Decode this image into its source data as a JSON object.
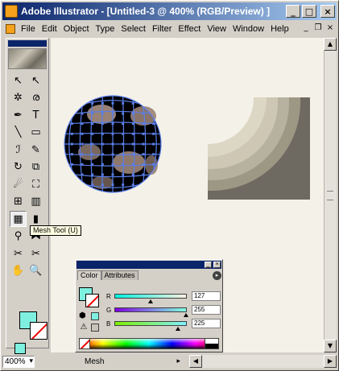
{
  "window": {
    "title": "Adobe Illustrator - [Untitled-3 @ 400% (RGB/Preview) ]",
    "minimize_label": "_",
    "maximize_label": "□",
    "close_label": "×"
  },
  "menubar": {
    "items": [
      "File",
      "Edit",
      "Object",
      "Type",
      "Select",
      "Filter",
      "Effect",
      "View",
      "Window",
      "Help"
    ],
    "doc_minimize": "_",
    "doc_restore": "❐",
    "doc_close": "×"
  },
  "toolbox": {
    "tooltip": "Mesh Tool (U)",
    "tools": [
      {
        "name": "selection-tool",
        "glyph": "↖"
      },
      {
        "name": "direct-selection-tool",
        "glyph": "↖"
      },
      {
        "name": "magic-wand-tool",
        "glyph": "✲"
      },
      {
        "name": "lasso-tool",
        "glyph": "ര"
      },
      {
        "name": "pen-tool",
        "glyph": "✒"
      },
      {
        "name": "type-tool",
        "glyph": "T"
      },
      {
        "name": "line-tool",
        "glyph": "╲"
      },
      {
        "name": "rectangle-tool",
        "glyph": "▭"
      },
      {
        "name": "paintbrush-tool",
        "glyph": "ℐ"
      },
      {
        "name": "pencil-tool",
        "glyph": "✎"
      },
      {
        "name": "rotate-tool",
        "glyph": "↻"
      },
      {
        "name": "scale-tool",
        "glyph": "⧉"
      },
      {
        "name": "warp-tool",
        "glyph": "☄"
      },
      {
        "name": "free-transform-tool",
        "glyph": "⛶"
      },
      {
        "name": "symbol-sprayer-tool",
        "glyph": "⊞"
      },
      {
        "name": "graph-tool",
        "glyph": "▥"
      },
      {
        "name": "mesh-tool",
        "glyph": "▦"
      },
      {
        "name": "gradient-tool",
        "glyph": "▮"
      },
      {
        "name": "eyedropper-tool",
        "glyph": "⚲"
      },
      {
        "name": "blend-tool",
        "glyph": "⧓"
      },
      {
        "name": "slice-tool",
        "glyph": "✂"
      },
      {
        "name": "scissors-tool",
        "glyph": "✂"
      },
      {
        "name": "hand-tool",
        "glyph": "✋"
      },
      {
        "name": "zoom-tool",
        "glyph": "🔍"
      }
    ]
  },
  "status": {
    "zoom": "400%",
    "tool": "Mesh"
  },
  "color_panel": {
    "tabs": [
      "Color",
      "Attributes"
    ],
    "menu_glyph": "▸",
    "warning_glyph": "⚠",
    "fill_color": "#7ff0e0",
    "channels": [
      {
        "label": "R",
        "value": "127",
        "level": 0.498,
        "gradient": "linear-gradient(90deg, #00f0e0, #fff0e0)"
      },
      {
        "label": "G",
        "value": "255",
        "level": 1.0,
        "gradient": "linear-gradient(90deg, #7f00e0, #7fffe0)"
      },
      {
        "label": "B",
        "value": "225",
        "level": 0.882,
        "gradient": "linear-gradient(90deg, #7ff000, #7ff0ff)"
      }
    ]
  }
}
